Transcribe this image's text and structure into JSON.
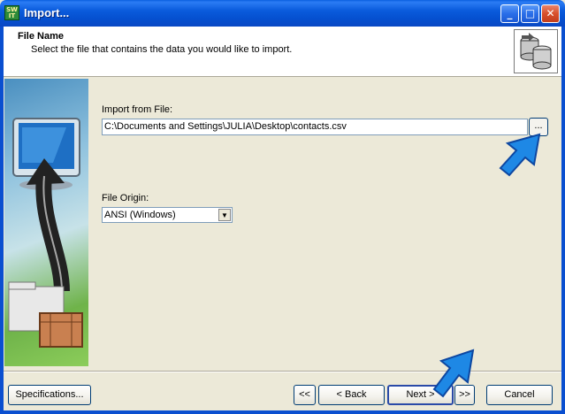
{
  "window": {
    "title": "Import...",
    "app_icon_text": "SW\nIT",
    "controls": {
      "minimize": "_",
      "maximize": "□",
      "close": "✕"
    }
  },
  "header": {
    "title": "File Name",
    "subtitle": "Select the file that contains the data you would like to import.",
    "icon": "database-import-icon"
  },
  "form": {
    "import_label": "Import from File:",
    "import_value": "C:\\Documents and Settings\\JULIA\\Desktop\\contacts.csv",
    "browse_label": "...",
    "origin_label": "File Origin:",
    "origin_value": "ANSI (Windows)"
  },
  "footer": {
    "specifications": "Specifications...",
    "first": "<<",
    "back": "< Back",
    "next": "Next >",
    "last": ">>",
    "cancel": "Cancel"
  },
  "colors": {
    "titlebar": "#0a5bdc",
    "dialog_bg": "#ece9d8",
    "pointer_blue": "#1e88e5"
  }
}
